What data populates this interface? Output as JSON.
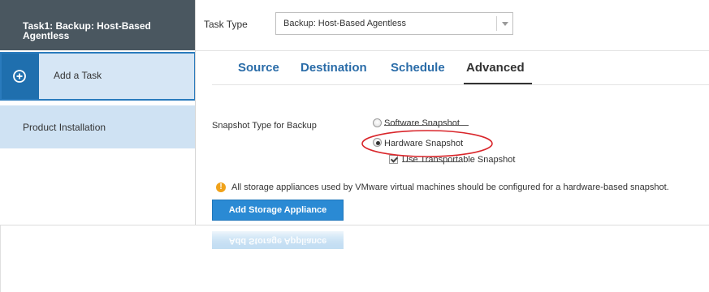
{
  "sidebar": {
    "task_header": "Task1: Backup: Host-Based Agentless",
    "add_task_label": "Add a Task",
    "product_installation_label": "Product Installation"
  },
  "task_type": {
    "label": "Task Type",
    "selected": "Backup: Host-Based Agentless"
  },
  "tabs": [
    {
      "label": "Source",
      "active": false
    },
    {
      "label": "Destination",
      "active": false
    },
    {
      "label": "Schedule",
      "active": false
    },
    {
      "label": "Advanced",
      "active": true
    }
  ],
  "snapshot": {
    "label": "Snapshot Type for Backup",
    "options": [
      {
        "label": "Software Snapshot",
        "selected": false
      },
      {
        "label": "Hardware Snapshot",
        "selected": true
      }
    ],
    "transportable_label": "Use Transportable Snapshot",
    "transportable_checked": true
  },
  "info": {
    "icon": "!",
    "text": "All storage appliances used by VMware virtual machines should be configured for a hardware-based snapshot."
  },
  "buttons": {
    "add_storage": "Add Storage Appliance"
  },
  "colors": {
    "sidebar_header": "#4a5760",
    "accent": "#2a6ca8",
    "button": "#2a8ad4",
    "highlight_ellipse": "#d9262b",
    "warning": "#f0a21a"
  }
}
